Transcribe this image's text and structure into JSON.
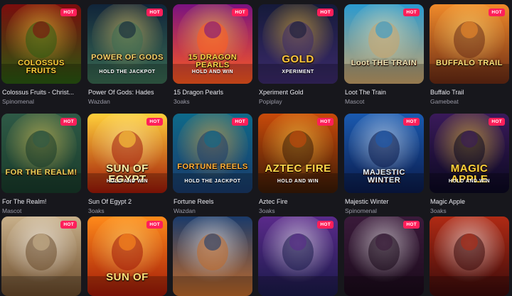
{
  "hot_label": "HOT",
  "rows": [
    [
      {
        "name": "Colossus Fruits - Christ...",
        "provider": "Spinomenal",
        "art_title": "COLOSSUS FRUITS",
        "art_sub": "",
        "icon": "colossus-fruits-thumbnail",
        "bg1": "#7a0d0d",
        "bg2": "#2a5a12",
        "accent": "#ffd23a",
        "hot": true
      },
      {
        "name": "Power Of Gods: Hades",
        "provider": "Wazdan",
        "art_title": "POWER OF GODS",
        "art_sub": "HOLD THE JACKPOT",
        "icon": "power-of-gods-thumbnail",
        "bg1": "#10243a",
        "bg2": "#3a6b52",
        "accent": "#f4d36a",
        "hot": true
      },
      {
        "name": "15 Dragon Pearls",
        "provider": "3oaks",
        "art_title": "15 DRAGON PEARLS",
        "art_sub": "HOLD AND WIN",
        "icon": "dragon-pearls-thumbnail",
        "bg1": "#7a1280",
        "bg2": "#ff5a1f",
        "accent": "#ffd84a",
        "hot": true
      },
      {
        "name": "Xperiment Gold",
        "provider": "Popiplay",
        "art_title": "GOLD",
        "art_sub": "XPERIMENT",
        "icon": "xperiment-gold-thumbnail",
        "bg1": "#151a3a",
        "bg2": "#3b2a6a",
        "accent": "#ffc83a",
        "hot": true
      },
      {
        "name": "Loot The Train",
        "provider": "Mascot",
        "art_title": "Loot THE TRAIN",
        "art_sub": "",
        "icon": "loot-the-train-thumbnail",
        "bg1": "#2a9ad0",
        "bg2": "#c9a36a",
        "accent": "#f2e5b5",
        "hot": true
      },
      {
        "name": "Buffalo Trail",
        "provider": "Gamebeat",
        "art_title": "BUFFALO TRAIL",
        "art_sub": "",
        "icon": "buffalo-trail-thumbnail",
        "bg1": "#f08a2a",
        "bg2": "#6a2a14",
        "accent": "#ffe27a",
        "hot": true
      }
    ],
    [
      {
        "name": "For The Realm!",
        "provider": "Mascot",
        "art_title": "FOR THE REALM!",
        "art_sub": "",
        "icon": "for-the-realm-thumbnail",
        "bg1": "#2e5a46",
        "bg2": "#183a2a",
        "accent": "#f2d25a",
        "hot": true
      },
      {
        "name": "Sun Of Egypt 2",
        "provider": "3oaks",
        "art_title": "SUN OF EGYPT",
        "art_sub": "HOLD AND WIN",
        "icon": "sun-of-egypt-thumbnail",
        "bg1": "#ffcf3a",
        "bg2": "#a01808",
        "accent": "#fff2a8",
        "hot": true
      },
      {
        "name": "Fortune Reels",
        "provider": "Wazdan",
        "art_title": "FORTUNE REELS",
        "art_sub": "HOLD THE JACKPOT",
        "icon": "fortune-reels-thumbnail",
        "bg1": "#0e6a8a",
        "bg2": "#1a3a6a",
        "accent": "#ffb23a",
        "hot": true
      },
      {
        "name": "Aztec Fire",
        "provider": "3oaks",
        "art_title": "AZTEC FIRE",
        "art_sub": "HOLD AND WIN",
        "icon": "aztec-fire-thumbnail",
        "bg1": "#c84a0a",
        "bg2": "#3a1a06",
        "accent": "#ffd84a",
        "hot": true
      },
      {
        "name": "Majestic Winter",
        "provider": "Spinomenal",
        "art_title": "MAJESTIC WINTER",
        "art_sub": "",
        "icon": "majestic-winter-thumbnail",
        "bg1": "#1a5ab0",
        "bg2": "#0a1a4a",
        "accent": "#e8f4ff",
        "hot": true
      },
      {
        "name": "Magic Apple",
        "provider": "3oaks",
        "art_title": "MAGIC APPLE",
        "art_sub": "HOLD AND WIN",
        "icon": "magic-apple-thumbnail",
        "bg1": "#3a1a5a",
        "bg2": "#0a0820",
        "accent": "#ffd23a",
        "hot": true
      }
    ],
    [
      {
        "name": "",
        "provider": "",
        "art_title": "",
        "art_sub": "",
        "icon": "winged-hero-thumbnail",
        "bg1": "#c8b08a",
        "bg2": "#6a4a2a",
        "accent": "#ffffff",
        "hot": true
      },
      {
        "name": "",
        "provider": "",
        "art_title": "SUN OF",
        "art_sub": "",
        "icon": "sun-of-thumbnail",
        "bg1": "#ff8a1a",
        "bg2": "#a01808",
        "accent": "#ffe27a",
        "hot": true
      },
      {
        "name": "",
        "provider": "",
        "art_title": "",
        "art_sub": "",
        "icon": "wolf-thumbnail",
        "bg1": "#1a3a6a",
        "bg2": "#c06a2a",
        "accent": "#ffffff",
        "hot": false
      },
      {
        "name": "",
        "provider": "",
        "art_title": "",
        "art_sub": "",
        "icon": "wolf-woman-thumbnail",
        "bg1": "#5a2a8a",
        "bg2": "#1a1a4a",
        "accent": "#ffffff",
        "hot": true
      },
      {
        "name": "",
        "provider": "",
        "art_title": "",
        "art_sub": "",
        "icon": "bandit-thumbnail",
        "bg1": "#3a1a3a",
        "bg2": "#1a0a1a",
        "accent": "#ffffff",
        "hot": true
      },
      {
        "name": "",
        "provider": "",
        "art_title": "",
        "art_sub": "",
        "icon": "mariachi-thumbnail",
        "bg1": "#b02a14",
        "bg2": "#3a0a0a",
        "accent": "#ffffff",
        "hot": false
      }
    ]
  ]
}
